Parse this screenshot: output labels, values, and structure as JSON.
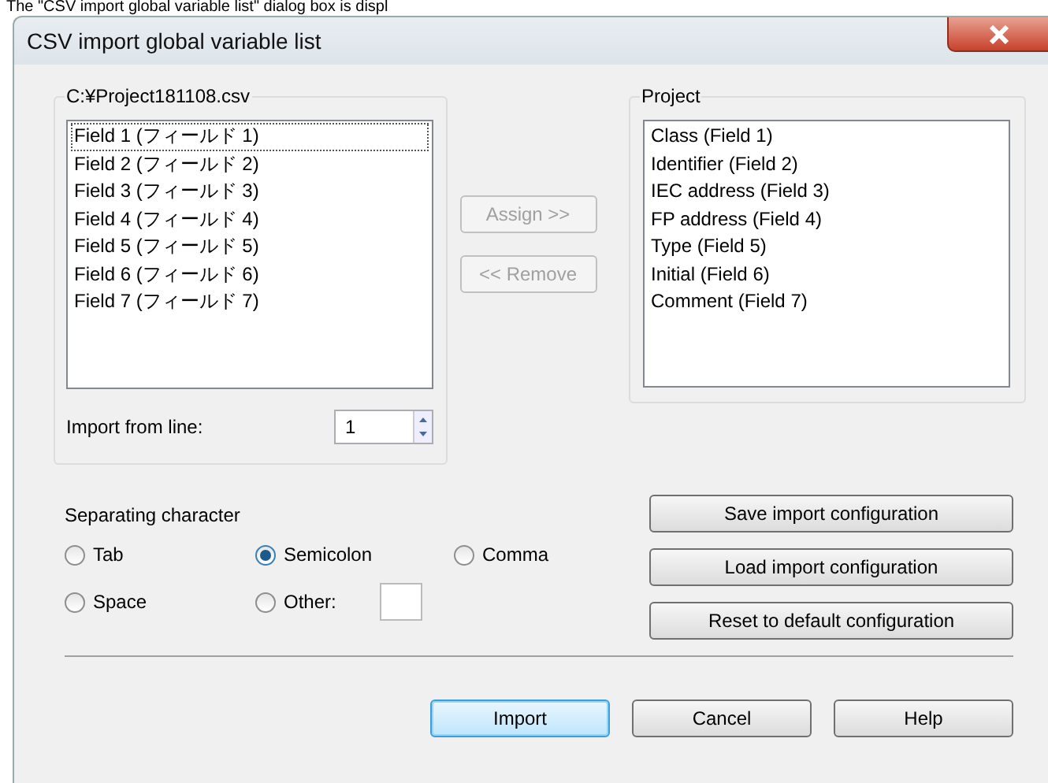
{
  "caption": "The \"CSV import global variable list\" dialog box is displ",
  "window": {
    "title": "CSV import global variable list"
  },
  "source": {
    "label": "C:¥Project181108.csv",
    "items": [
      {
        "label": "Field 1 (フィールド 1)",
        "focused": true
      },
      {
        "label": "Field 2 (フィールド 2)",
        "focused": false
      },
      {
        "label": "Field 3 (フィールド 3)",
        "focused": false
      },
      {
        "label": "Field 4 (フィールド 4)",
        "focused": false
      },
      {
        "label": "Field 5 (フィールド 5)",
        "focused": false
      },
      {
        "label": "Field 6 (フィールド 6)",
        "focused": false
      },
      {
        "label": "Field 7 (フィールド 7)",
        "focused": false
      }
    ],
    "import_from_line": {
      "label": "Import from line:",
      "value": "1"
    }
  },
  "move_buttons": [
    {
      "label": "Assign >>",
      "disabled": true
    },
    {
      "label": "<< Remove",
      "disabled": true
    }
  ],
  "project": {
    "label": "Project",
    "items": [
      "Class (Field 1)",
      "Identifier (Field 2)",
      "IEC address (Field 3)",
      "FP address (Field 4)",
      "Type (Field 5)",
      "Initial (Field 6)",
      "Comment (Field 7)"
    ]
  },
  "separating": {
    "label": "Separating character",
    "options": [
      {
        "label": "Tab",
        "selected": false
      },
      {
        "label": "Semicolon",
        "selected": true
      },
      {
        "label": "Comma",
        "selected": false
      },
      {
        "label": "Space",
        "selected": false
      },
      {
        "label": "Other:",
        "selected": false,
        "kind": "other"
      }
    ]
  },
  "config_buttons": [
    "Save import configuration",
    "Load import configuration",
    "Reset to default configuration"
  ],
  "dialog_buttons": [
    {
      "label": "Import",
      "default": true
    },
    {
      "label": "Cancel",
      "default": false
    },
    {
      "label": "Help",
      "default": false
    }
  ]
}
